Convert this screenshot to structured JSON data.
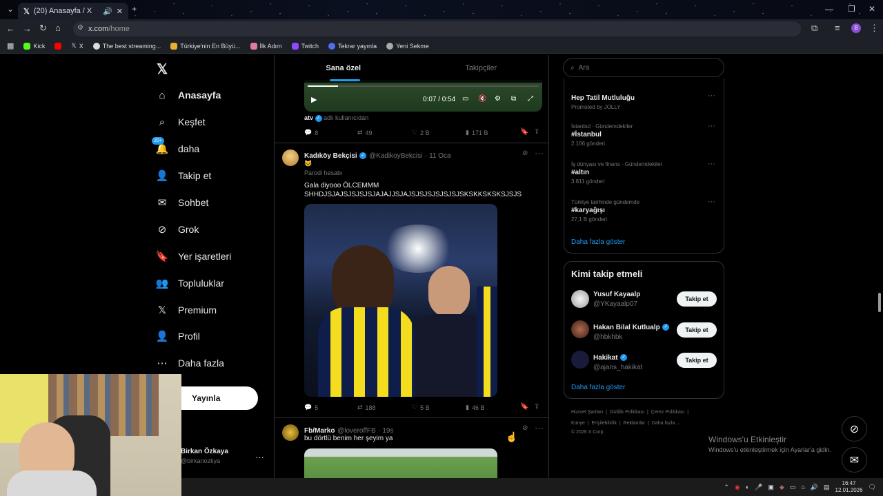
{
  "browser": {
    "tab_title": "(20) Anasayfa / X",
    "url_prefix": "x.com",
    "url_path": "/home",
    "bookmarks": [
      "Kick",
      "X",
      "The best streaming...",
      "Türkiye'nin En Büyü...",
      "İlk Adım",
      "Twitch",
      "Tekrar yayınla",
      "Yeni Sekme"
    ]
  },
  "nav": {
    "items": [
      {
        "label": "Anasayfa",
        "icon": "home-icon"
      },
      {
        "label": "Keşfet",
        "icon": "search-icon"
      },
      {
        "label": "daha",
        "icon": "bell-icon",
        "badge": "20+"
      },
      {
        "label": "Takip et",
        "icon": "person-add-icon"
      },
      {
        "label": "Sohbet",
        "icon": "mail-icon"
      },
      {
        "label": "Grok",
        "icon": "grok-icon"
      },
      {
        "label": "Yer işaretleri",
        "icon": "bookmark-icon"
      },
      {
        "label": "Topluluklar",
        "icon": "people-icon"
      },
      {
        "label": "Premium",
        "icon": "x-logo-icon"
      },
      {
        "label": "Profil",
        "icon": "person-icon"
      },
      {
        "label": "Daha fazla",
        "icon": "more-circle-icon"
      }
    ],
    "post_label": "Yayınla",
    "account_name": "Birkan Özkaya",
    "account_handle": "@birkanozkya"
  },
  "feed": {
    "tabs": [
      "Sana özel",
      "Takipçiler"
    ],
    "video1": {
      "time": "0:07 / 0:54",
      "source": "atv",
      "source_suffix": "adlı kullanıcıdan",
      "replies": "8",
      "reposts": "49",
      "likes": "2 B",
      "views": "171 B"
    },
    "post1": {
      "name": "Kadıköy Bekçisi",
      "handle": "@KadikoyBekcisi",
      "date": "· 11 Oca",
      "emoji": "😺",
      "parody": "Parodi hesabı",
      "text1": "Gala diyooo ÖLCEMMM",
      "text2": "SHHDJSJAJSJSJSJSJAJAJJSJAJSJSJSJSJSJSJSKSKKSKSKSJSJS",
      "replies": "5",
      "reposts": "188",
      "likes": "5 B",
      "views": "46 B"
    },
    "post2": {
      "name": "Fb/Marko",
      "handle": "@loveroffFB",
      "date": "· 19s",
      "text": "bu dörtlü benim her şeyim ya"
    }
  },
  "right": {
    "search_placeholder": "Ara",
    "promo_title": "Hep Tatil Mutluluğu",
    "promo_sub": "Promoted by JOLLY",
    "trends": [
      {
        "ctx": "İstanbul · Gündemdekiler",
        "title": "#İstanbul",
        "count": "2.106 gönderi"
      },
      {
        "ctx": "İş dünyası ve finans · Gündemdekiler",
        "title": "#altın",
        "count": "3.811 gönderi"
      },
      {
        "ctx": "Türkiye tarihinde gündemde",
        "title": "#karyağışı",
        "count": "27,1 B gönderi"
      }
    ],
    "show_more": "Daha fazla göster",
    "who_title": "Kimi takip etmeli",
    "who": [
      {
        "name": "Yusuf Kayaalp",
        "handle": "@YKayaalp07",
        "btn": "Takip et"
      },
      {
        "name": "Hakan Bilal Kutlualp",
        "handle": "@hbkhbk",
        "btn": "Takip et"
      },
      {
        "name": "Hakikat",
        "handle": "@ajans_hakikat",
        "btn": "Takip et"
      }
    ],
    "footer1": [
      "Hizmet Şartları",
      "Gizlilik Politikası",
      "Çerez Politikası"
    ],
    "footer2": [
      "Künye",
      "Erişilebilirlik",
      "Reklamlar",
      "Daha fazla ..."
    ],
    "copyright": "© 2026 X Corp."
  },
  "watermark": {
    "title": "Windows'u Etkinleştir",
    "sub": "Windows'u etkinleştirmek için Ayarlar'a gidin."
  },
  "taskbar": {
    "time": "16:47",
    "date": "12.01.2026"
  }
}
